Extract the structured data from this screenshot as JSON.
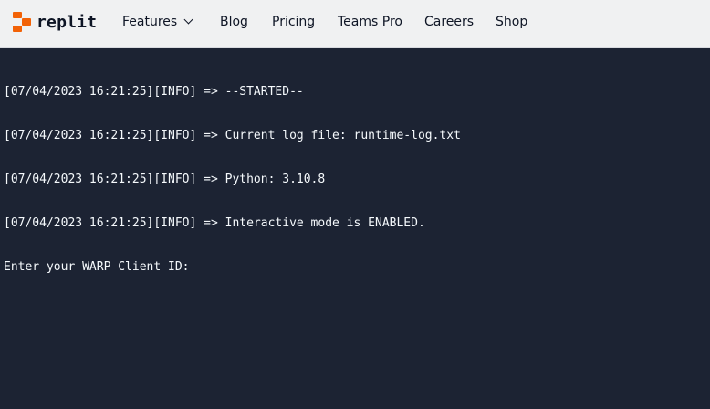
{
  "header": {
    "brand": {
      "name": "replit"
    },
    "nav": {
      "features": "Features",
      "blog": "Blog",
      "pricing": "Pricing",
      "teams_pro": "Teams Pro",
      "careers": "Careers",
      "shop": "Shop"
    }
  },
  "console": {
    "lines": [
      "[07/04/2023 16:21:25][INFO] => --STARTED--",
      "[07/04/2023 16:21:25][INFO] => Current log file: runtime-log.txt",
      "[07/04/2023 16:21:25][INFO] => Python: 3.10.8",
      "[07/04/2023 16:21:25][INFO] => Interactive mode is ENABLED.",
      "Enter your WARP Client ID: "
    ]
  },
  "colors": {
    "brand_orange": "#f26207",
    "console_background": "#1c2333",
    "console_text": "#f5f9fc",
    "header_background": "#f0f1f2"
  }
}
